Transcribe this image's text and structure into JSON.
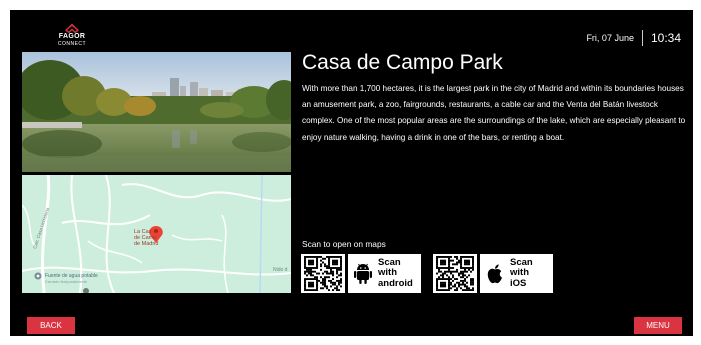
{
  "header": {
    "logo_top": "FAGOR",
    "logo_bottom": "CONNECT",
    "date": "Fri, 07 June",
    "time": "10:34"
  },
  "content": {
    "title": "Casa de Campo Park",
    "description": "With more than 1,700 hectares, it is the largest park in the city of Madrid and within its boundaries houses an amusement park, a zoo, fairgrounds, restaurants, a cable car and the Venta del Batán livestock complex. One of the most popular areas are the surroundings of the lake, which are especially pleasant to enjoy nature walking, having a drink in one of the bars, or renting a boat.",
    "scan_prompt": "Scan to open on maps"
  },
  "map": {
    "pin_label_line1": "La Cas",
    "pin_label_line2": "de Camp",
    "pin_label_line3": "de Madrid",
    "poi_label": "Fuente de agua potable",
    "poi_sub": "Cerrado temporalmente",
    "road_label": "Carr. Casa Uchistoria",
    "edge_label": "Nido d"
  },
  "scan": {
    "android_line1": "Scan",
    "android_line2": "with",
    "android_line3": "android",
    "ios_line1": "Scan",
    "ios_line2": "with",
    "ios_line3": "iOS"
  },
  "footer": {
    "back_label": "BACK",
    "menu_label": "MENU"
  },
  "colors": {
    "background": "#000000",
    "accent": "#d93440",
    "map": "#cdeedd"
  }
}
